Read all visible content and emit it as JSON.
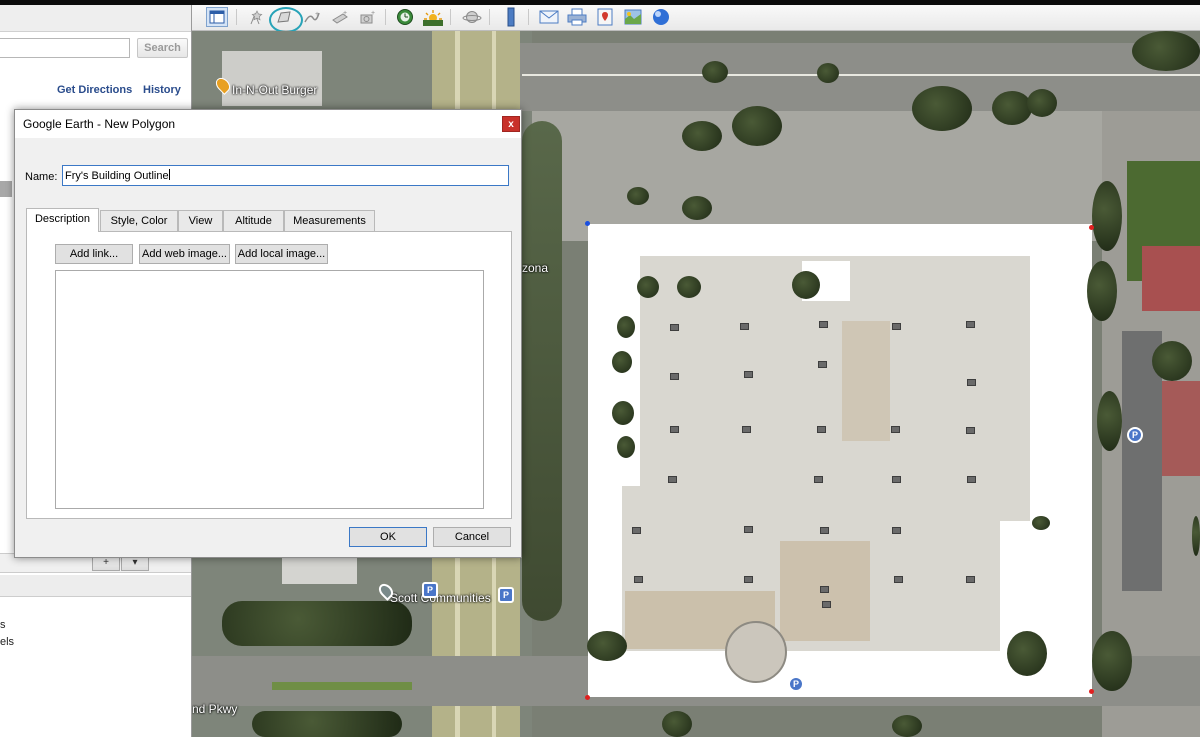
{
  "search": {
    "button_label": "Search",
    "placeholder": ""
  },
  "left_panel": {
    "links": {
      "directions": "Get Directions",
      "history": "History"
    },
    "control_icons": {
      "add": "+",
      "dropdown": "▾"
    },
    "layer_text_1": "s",
    "layer_text_2": "els"
  },
  "toolbar": {
    "icons": [
      "sidebar-icon",
      "placemark-icon",
      "polygon-icon",
      "path-icon",
      "image-overlay-icon",
      "record-tour-icon",
      "historical-imagery-icon",
      "sunlight-icon",
      "planets-icon",
      "ruler-icon",
      "email-icon",
      "print-icon",
      "save-image-icon",
      "view-in-maps-icon",
      "earth-icon"
    ]
  },
  "map": {
    "labels": {
      "in_n_out": "In-N-Out Burger",
      "scott": "Scott Communities",
      "zona": "zona",
      "pkwy": "nd Pkwy"
    },
    "pin_letter": "P",
    "polygon_vertex_colors": {
      "first": "#1a4fe0",
      "other": "#e02020"
    }
  },
  "dialog": {
    "title": "Google Earth - New Polygon",
    "close_label": "x",
    "name_label": "Name:",
    "name_value": "Fry's Building Outline",
    "tabs": [
      "Description",
      "Style, Color",
      "View",
      "Altitude",
      "Measurements"
    ],
    "active_tab": "Description",
    "buttons": {
      "add_link": "Add link...",
      "add_web_image": "Add web image...",
      "add_local_image": "Add local image..."
    },
    "description_value": "",
    "ok": "OK",
    "cancel": "Cancel"
  },
  "colors": {
    "annotation_circle": "#27a3b8",
    "close_button": "#c8312a",
    "link": "#2a4c8c"
  }
}
